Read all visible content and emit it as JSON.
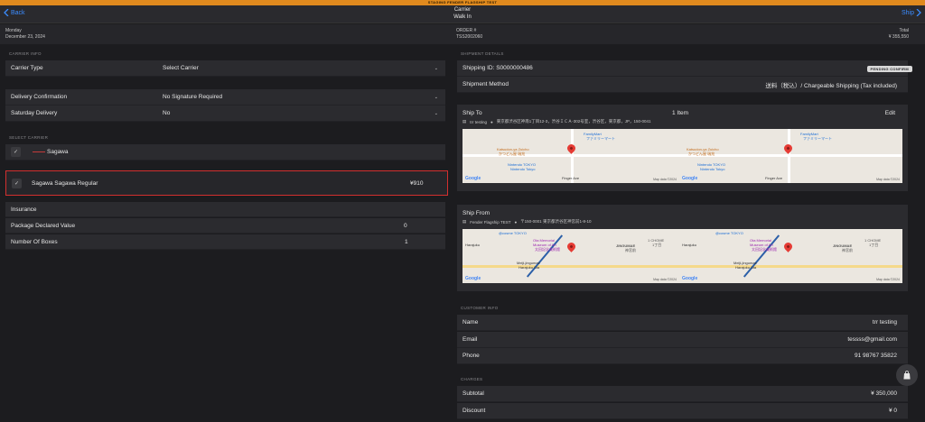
{
  "staging_banner": "STAGING FENDER FLAGSHIP TEST",
  "nav": {
    "back_label": "Back",
    "title": "Carrier",
    "subtitle": "Walk In",
    "next_label": "Ship"
  },
  "info": {
    "day": "Monday",
    "date": "December 23, 2024",
    "order_label": "ORDER #",
    "order_number": "TSS2002060",
    "total_label": "Total",
    "total_value": "¥ 355,550"
  },
  "carrier_info": {
    "section_label": "CARRIER INFO",
    "carrier_type_label": "Carrier Type",
    "carrier_type_value": "Select Carrier",
    "delivery_confirmation_label": "Delivery Confirmation",
    "delivery_confirmation_value": "No Signature Required",
    "saturday_delivery_label": "Saturday Delivery",
    "saturday_delivery_value": "No"
  },
  "select_carrier": {
    "section_label": "SELECT CARRIER",
    "carrier_name": "Sagawa",
    "service_name": "Sagawa Sagawa Regular",
    "service_price": "¥910"
  },
  "insurance": {
    "title": "Insurance",
    "package_declared_label": "Package Declared Value",
    "package_declared_value": "0",
    "number_of_boxes_label": "Number Of Boxes",
    "number_of_boxes_value": "1"
  },
  "shipment": {
    "section_label": "SHIPMENT DETAILS",
    "shipping_id": "Shipping ID: S0000000486",
    "status_badge": "PENDING CONFIRM",
    "method_label": "Shipment Method",
    "method_value": "送料（税込）/ Chargeable Shipping (Tax included)"
  },
  "ship_to": {
    "title": "Ship To",
    "item_count": "1 Item",
    "edit_label": "Edit",
    "name": "trr testing",
    "address": "東京都渋谷区神南1丁目12-3，渋谷ＩＣＡ-302号室，渋谷区，東京都，JP，150-0041",
    "map": {
      "google": "Google",
      "map_data": "Map data ©2024",
      "poi_1": "Katsudon-ya Zuicho",
      "poi_1_jp": "かつどん屋 瑞兆",
      "poi_2": "Nintendo TOKYO",
      "poi_2_jp": "Nintendo Tokyo",
      "poi_3": "FamilyMart",
      "poi_3_jp": "ファミリーマート",
      "street": "Finger Ave"
    }
  },
  "ship_from": {
    "title": "Ship From",
    "name": "Fender Flagship TEST",
    "address": "〒150-0001 東京都渋谷区神宮前1-8-10",
    "map": {
      "google": "Google",
      "map_data": "Map data ©2024",
      "poi_1": "@cosme TOKYO",
      "poi_2": "Ota Memorial",
      "poi_2b": "Museum of Art",
      "poi_2_jp": "太田記念美術館",
      "poi_3": "Harajuku",
      "poi_4": "Meiji-jingumae",
      "poi_4b": "Harajuku Sta",
      "area": "JINGUMAE",
      "area_jp": "神宮前",
      "chome": "1 CHOME",
      "chome_jp": "1丁目"
    }
  },
  "customer": {
    "section_label": "CUSTOMER INFO",
    "name_label": "Name",
    "name_value": "trr testing",
    "email_label": "Email",
    "email_value": "tessss@gmail.com",
    "phone_label": "Phone",
    "phone_value": "91 98767 35822"
  },
  "charges": {
    "section_label": "CHARGES",
    "subtotal_label": "Subtotal",
    "subtotal_value": "¥ 350,000",
    "discount_label": "Discount",
    "discount_value": "¥ 0"
  },
  "colors": {
    "accent": "#3b8cff",
    "banner": "#e08a1e",
    "highlight_border": "#d32f2f",
    "background": "#1c1c1f",
    "row": "#2b2b2f"
  },
  "icons": {
    "back": "chevron-left-icon",
    "next": "chevron-right-icon",
    "check": "checkmark-icon",
    "cart": "shopping-bag-icon",
    "pin": "map-pin-icon"
  }
}
